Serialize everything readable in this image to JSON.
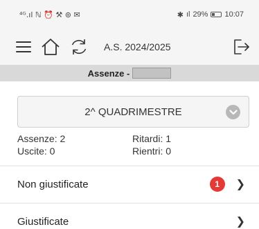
{
  "status_bar": {
    "left_glyphs": "⁴ᴳ.ıl ℕ ⏰ ⚒ ⊚ ✉",
    "bluetooth": "✱",
    "signal": "ıl",
    "battery_percent": "29%",
    "time": "10:07"
  },
  "toolbar": {
    "school_year": "A.S. 2024/2025"
  },
  "header": {
    "title": "Assenze -"
  },
  "period": {
    "selected": "2^ QUADRIMESTRE"
  },
  "stats": {
    "assenze": "Assenze: 2",
    "ritardi": "Ritardi: 1",
    "uscite": "Uscite: 0",
    "rientri": "Rientri: 0"
  },
  "list": [
    {
      "label": "Non giustificate",
      "badge": "1"
    },
    {
      "label": "Giustificate"
    }
  ],
  "colors": {
    "badge": "#e53935",
    "toolbar_bg": "#f5f5f5",
    "subheader_bg": "#d9d9d9"
  }
}
